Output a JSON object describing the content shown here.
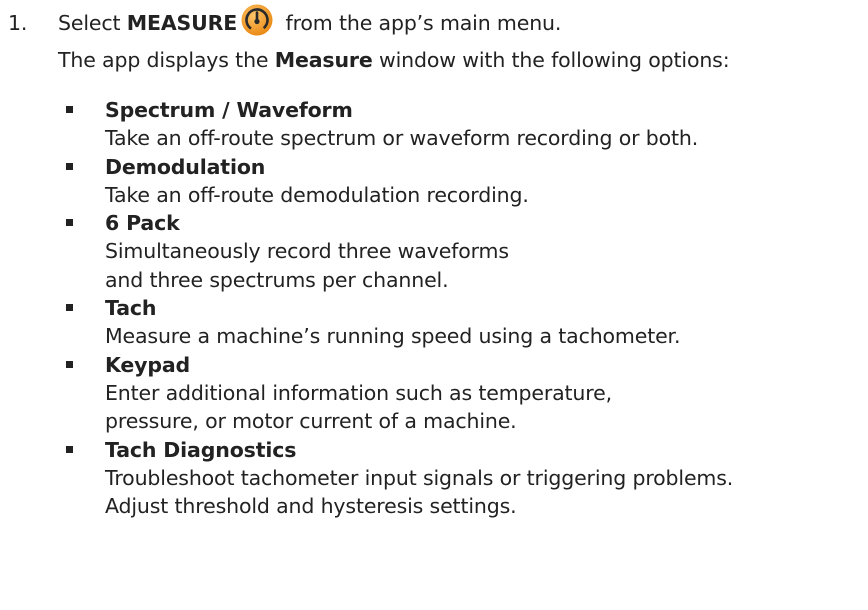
{
  "step": {
    "number": "1.",
    "pre_text": "Select ",
    "action_label": "MEASURE",
    "post_text": " from the app’s main menu.",
    "icon": "gauge-icon",
    "icon_color": "#F09A2C"
  },
  "intro": {
    "pre_text": "The app displays the ",
    "window_name": "Measure",
    "post_text": " window with the following options:"
  },
  "options": [
    {
      "title": "Spectrum / Waveform",
      "description": [
        "Take an off-route spectrum or waveform recording or both."
      ]
    },
    {
      "title": "Demodulation",
      "description": [
        "Take an off-route demodulation recording."
      ]
    },
    {
      "title": "6 Pack",
      "description": [
        "Simultaneously record three waveforms",
        "and three spectrums per channel."
      ]
    },
    {
      "title": "Tach",
      "description": [
        "Measure a machine’s running speed using a tachometer."
      ]
    },
    {
      "title": "Keypad",
      "description": [
        "Enter additional information such as temperature,",
        "pressure, or motor current of a machine."
      ]
    },
    {
      "title": "Tach Diagnostics",
      "description": [
        "Troubleshoot tachometer input signals or triggering problems.",
        "Adjust threshold and hysteresis settings."
      ]
    }
  ]
}
